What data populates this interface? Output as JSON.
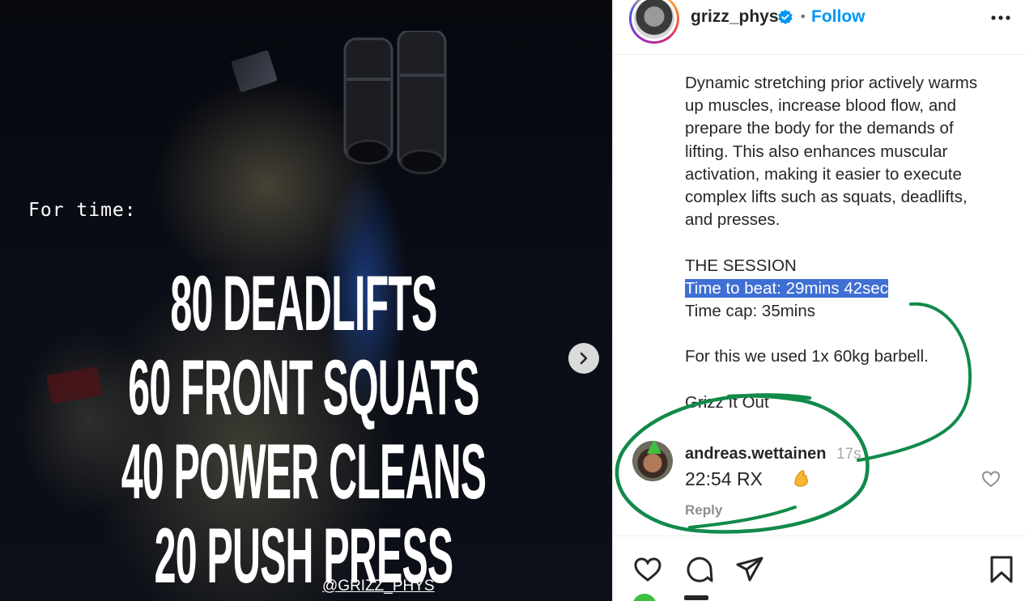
{
  "media": {
    "overlay_intro": "For time:",
    "workout_lines": [
      "80 DEADLIFTS",
      "60 FRONT SQUATS",
      "40 POWER CLEANS",
      "20 PUSH PRESS"
    ],
    "handle": "@GRIZZ_PHYS",
    "next_icon": "chevron-right-icon"
  },
  "header": {
    "username": "grizz_phys",
    "verified_icon": "verified-badge-icon",
    "separator": "•",
    "follow_label": "Follow",
    "more_icon": "more-options-icon"
  },
  "caption": {
    "paragraph1": [
      "Dynamic stretching prior actively warms",
      "up muscles, increase blood flow, and",
      "prepare the body for the demands of",
      "lifting. This also enhances muscular",
      "activation, making it easier to execute",
      "complex lifts such as squats, deadlifts,",
      "and presses."
    ],
    "session_heading": "THE SESSION",
    "time_to_beat": "Time to beat: 29mins 42sec",
    "time_cap": "Time cap: 35mins",
    "equipment": "For this we used 1x 60kg barbell.",
    "signoff": "Grizz It Out"
  },
  "comment": {
    "username": "andreas.wettainen",
    "time": "17s",
    "text": "22:54 RX",
    "emoji": "flexed-biceps-icon",
    "reply_label": "Reply"
  },
  "actions": {
    "icons": [
      "heart-icon",
      "comment-icon",
      "share-icon",
      "bookmark-icon"
    ]
  },
  "colors": {
    "follow_blue": "#0095f6",
    "highlight_blue": "#3f6fd4",
    "annotation_green": "#128a4a"
  }
}
